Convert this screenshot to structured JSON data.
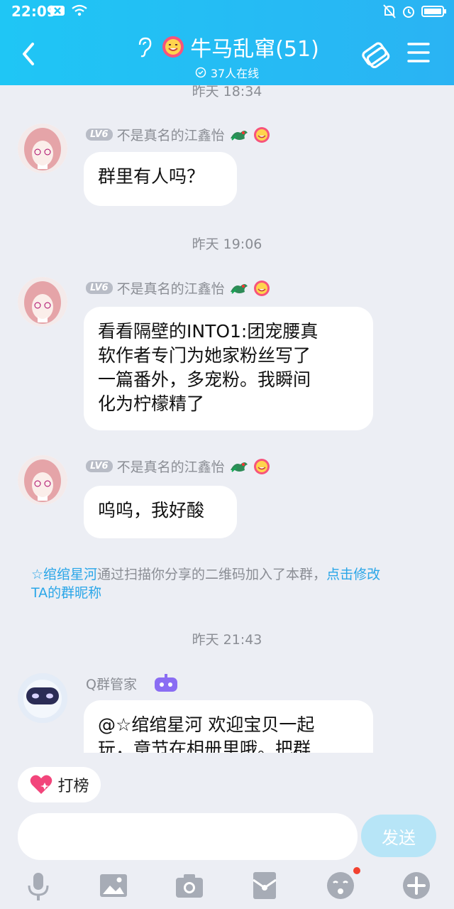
{
  "status_bar": {
    "time": "22:09"
  },
  "header": {
    "title": "牛马乱窜(51)",
    "online_count": "37人在线",
    "colors": {
      "bar": "#1fc6f5"
    }
  },
  "messages": [
    {
      "timestamp": "昨天 18:34",
      "level": "LV6",
      "sender": "不是真名的江鑫怡",
      "text": "群里有人吗？"
    },
    {
      "timestamp": "昨天 19:06",
      "level": "LV6",
      "sender": "不是真名的江鑫怡",
      "text_lines": [
        "看看隔壁的INTO1:团宠腰真",
        "软作者专门为她家粉丝写了",
        "一篇番外，多宠粉。我瞬间",
        "化为柠檬精了"
      ]
    },
    {
      "level": "LV6",
      "sender": "不是真名的江鑫怡",
      "text": "呜呜，我好酸"
    }
  ],
  "system_notice": {
    "name": "☆绾绾星河",
    "text": "通过扫描你分享的二维码加入了本群，",
    "link_part1": "点击修改",
    "link_part2": "TA的群昵称"
  },
  "bot_message": {
    "timestamp": "昨天 21:43",
    "sender": "Q群管家",
    "text_lines": [
      "@☆绾绾星河 欢迎宝贝一起",
      "玩，章节在相册里哦。把群"
    ]
  },
  "chips": {
    "dabang": "打榜"
  },
  "composer": {
    "input_value": "",
    "send_label": "发送"
  },
  "toolbar_icons": [
    "microphone-icon",
    "image-icon",
    "camera-icon",
    "red-packet-icon",
    "emoji-icon",
    "plus-icon"
  ]
}
